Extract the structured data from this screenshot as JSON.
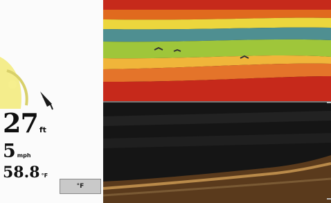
{
  "readouts": {
    "depth": {
      "value": "27",
      "unit": "ft"
    },
    "speed": {
      "value": "5",
      "unit": "mph"
    },
    "temperature": {
      "value": "58.8",
      "unit": "°F"
    }
  },
  "temperature_box": {
    "label": "°F"
  },
  "sonar": {
    "upper_label": "",
    "lower_label": ""
  },
  "colors": {
    "background_left": "#fbfbfb",
    "sonar_background": "#161616",
    "surface_red": "#c62a1b",
    "band_yellow": "#ecd63d",
    "band_teal": "#4f8f91",
    "band_green": "#9fc63a",
    "bottom_red": "#c6291b",
    "fish_yellow": "#f2ea78"
  },
  "icons": [
    "fish-arch-icon"
  ]
}
